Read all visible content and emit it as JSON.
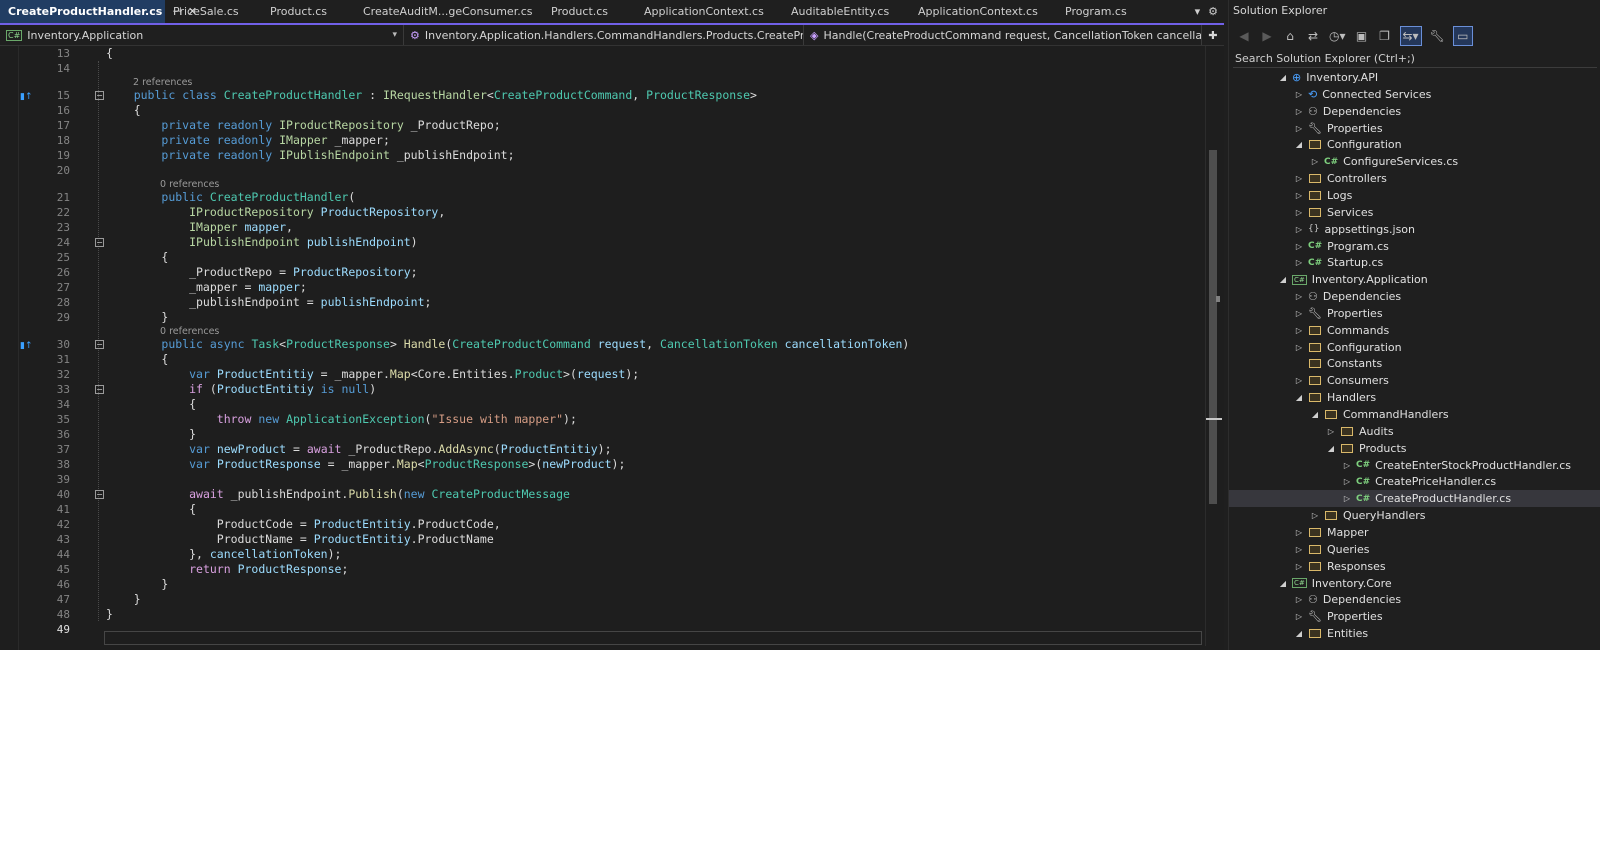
{
  "tabs": [
    {
      "label": "CreateProductHandler.cs",
      "active": true
    },
    {
      "label": "PriceSale.cs"
    },
    {
      "label": "Product.cs"
    },
    {
      "label": "CreateAuditM...geConsumer.cs"
    },
    {
      "label": "Product.cs"
    },
    {
      "label": "ApplicationContext.cs"
    },
    {
      "label": "AuditableEntity.cs"
    },
    {
      "label": "ApplicationContext.cs"
    },
    {
      "label": "Program.cs"
    }
  ],
  "tab_controls": {
    "pin": "⊣",
    "close": "✕",
    "dropdown": "▾",
    "gear": "⚙"
  },
  "navbar": {
    "project": "Inventory.Application",
    "type": "Inventory.Application.Handlers.CommandHandlers.Products.CreateProductH",
    "member": "Handle(CreateProductCommand request, CancellationToken cancellationTok",
    "add": "✚"
  },
  "code": {
    "current_line": "49",
    "lines": [
      {
        "n": "13",
        "tokens": [
          [
            "{",
            "pu"
          ]
        ]
      },
      {
        "n": "14",
        "tokens": []
      },
      {
        "n": "15",
        "lens": "2 references",
        "tokens": [
          [
            "    ",
            ""
          ],
          [
            "public",
            "kw"
          ],
          [
            " ",
            ""
          ],
          [
            "class",
            "kw"
          ],
          [
            " ",
            ""
          ],
          [
            "CreateProductHandler",
            "ty"
          ],
          [
            " : ",
            ""
          ],
          [
            "IRequestHandler",
            "if"
          ],
          [
            "<",
            ""
          ],
          [
            "CreateProductCommand",
            "ty"
          ],
          [
            ", ",
            ""
          ],
          [
            "ProductResponse",
            "ty"
          ],
          [
            ">",
            ""
          ]
        ]
      },
      {
        "n": "16",
        "tokens": [
          [
            "    {",
            ""
          ]
        ]
      },
      {
        "n": "17",
        "tokens": [
          [
            "        ",
            ""
          ],
          [
            "private",
            "kw"
          ],
          [
            " ",
            ""
          ],
          [
            "readonly",
            "kw"
          ],
          [
            " ",
            ""
          ],
          [
            "IProductRepository",
            "if"
          ],
          [
            " _ProductRepo;",
            ""
          ]
        ]
      },
      {
        "n": "18",
        "tokens": [
          [
            "        ",
            ""
          ],
          [
            "private",
            "kw"
          ],
          [
            " ",
            ""
          ],
          [
            "readonly",
            "kw"
          ],
          [
            " ",
            ""
          ],
          [
            "IMapper",
            "if"
          ],
          [
            " _mapper;",
            ""
          ]
        ]
      },
      {
        "n": "19",
        "tokens": [
          [
            "        ",
            ""
          ],
          [
            "private",
            "kw"
          ],
          [
            " ",
            ""
          ],
          [
            "readonly",
            "kw"
          ],
          [
            " ",
            ""
          ],
          [
            "IPublishEndpoint",
            "if"
          ],
          [
            " _publishEndpoint;",
            ""
          ]
        ]
      },
      {
        "n": "20",
        "tokens": []
      },
      {
        "n": "21",
        "lens": "0 references",
        "tokens": [
          [
            "        ",
            ""
          ],
          [
            "public",
            "kw"
          ],
          [
            " ",
            ""
          ],
          [
            "CreateProductHandler",
            "ty"
          ],
          [
            "(",
            ""
          ]
        ]
      },
      {
        "n": "22",
        "tokens": [
          [
            "            ",
            ""
          ],
          [
            "IProductRepository",
            "if"
          ],
          [
            " ",
            ""
          ],
          [
            "ProductRepository",
            "pr"
          ],
          [
            ",",
            ""
          ]
        ]
      },
      {
        "n": "23",
        "tokens": [
          [
            "            ",
            ""
          ],
          [
            "IMapper",
            "if"
          ],
          [
            " ",
            ""
          ],
          [
            "mapper",
            "pr"
          ],
          [
            ",",
            ""
          ]
        ]
      },
      {
        "n": "24",
        "tokens": [
          [
            "            ",
            ""
          ],
          [
            "IPublishEndpoint",
            "if"
          ],
          [
            " ",
            ""
          ],
          [
            "publishEndpoint",
            "pr"
          ],
          [
            ")",
            ""
          ]
        ]
      },
      {
        "n": "25",
        "tokens": [
          [
            "        {",
            ""
          ]
        ]
      },
      {
        "n": "26",
        "tokens": [
          [
            "            _ProductRepo = ",
            ""
          ],
          [
            "ProductRepository",
            "pr"
          ],
          [
            ";",
            ""
          ]
        ]
      },
      {
        "n": "27",
        "tokens": [
          [
            "            _mapper = ",
            ""
          ],
          [
            "mapper",
            "pr"
          ],
          [
            ";",
            ""
          ]
        ]
      },
      {
        "n": "28",
        "tokens": [
          [
            "            _publishEndpoint = ",
            ""
          ],
          [
            "publishEndpoint",
            "pr"
          ],
          [
            ";",
            ""
          ]
        ]
      },
      {
        "n": "29",
        "tokens": [
          [
            "        }",
            ""
          ]
        ]
      },
      {
        "n": "30",
        "lens": "0 references",
        "tokens": [
          [
            "        ",
            ""
          ],
          [
            "public",
            "kw"
          ],
          [
            " ",
            ""
          ],
          [
            "async",
            "kw"
          ],
          [
            " ",
            ""
          ],
          [
            "Task",
            "ty"
          ],
          [
            "<",
            ""
          ],
          [
            "ProductResponse",
            "ty"
          ],
          [
            "> ",
            ""
          ],
          [
            "Handle",
            "fn"
          ],
          [
            "(",
            ""
          ],
          [
            "CreateProductCommand",
            "ty"
          ],
          [
            " ",
            ""
          ],
          [
            "request",
            "pr"
          ],
          [
            ", ",
            ""
          ],
          [
            "CancellationToken",
            "ty"
          ],
          [
            " ",
            ""
          ],
          [
            "cancellationToken",
            "pr"
          ],
          [
            ")",
            ""
          ]
        ]
      },
      {
        "n": "31",
        "tokens": [
          [
            "        {",
            ""
          ]
        ]
      },
      {
        "n": "32",
        "tokens": [
          [
            "            ",
            ""
          ],
          [
            "var",
            "kw"
          ],
          [
            " ",
            ""
          ],
          [
            "ProductEntitiy",
            "pr"
          ],
          [
            " = _mapper.",
            ""
          ],
          [
            "Map",
            "fn"
          ],
          [
            "<Core.Entities.",
            ""
          ],
          [
            "Product",
            "ty"
          ],
          [
            ">(",
            ""
          ],
          [
            "request",
            "pr"
          ],
          [
            ");",
            ""
          ]
        ]
      },
      {
        "n": "33",
        "tokens": [
          [
            "            ",
            ""
          ],
          [
            "if",
            "kw2"
          ],
          [
            " (",
            ""
          ],
          [
            "ProductEntitiy",
            "pr"
          ],
          [
            " ",
            ""
          ],
          [
            "is",
            "kw"
          ],
          [
            " ",
            ""
          ],
          [
            "null",
            "kw"
          ],
          [
            ")",
            ""
          ]
        ]
      },
      {
        "n": "34",
        "tokens": [
          [
            "            {",
            ""
          ]
        ]
      },
      {
        "n": "35",
        "tokens": [
          [
            "                ",
            ""
          ],
          [
            "throw",
            "kw2"
          ],
          [
            " ",
            ""
          ],
          [
            "new",
            "kw"
          ],
          [
            " ",
            ""
          ],
          [
            "ApplicationException",
            "ty"
          ],
          [
            "(",
            ""
          ],
          [
            "\"Issue with mapper\"",
            "st"
          ],
          [
            ");",
            ""
          ]
        ]
      },
      {
        "n": "36",
        "tokens": [
          [
            "            }",
            ""
          ]
        ]
      },
      {
        "n": "37",
        "tokens": [
          [
            "            ",
            ""
          ],
          [
            "var",
            "kw"
          ],
          [
            " ",
            ""
          ],
          [
            "newProduct",
            "pr"
          ],
          [
            " = ",
            ""
          ],
          [
            "await",
            "kw2"
          ],
          [
            " _ProductRepo.",
            ""
          ],
          [
            "AddAsync",
            "fn"
          ],
          [
            "(",
            ""
          ],
          [
            "ProductEntitiy",
            "pr"
          ],
          [
            ");",
            ""
          ]
        ]
      },
      {
        "n": "38",
        "tokens": [
          [
            "            ",
            ""
          ],
          [
            "var",
            "kw"
          ],
          [
            " ",
            ""
          ],
          [
            "ProductResponse",
            "pr"
          ],
          [
            " = _mapper.",
            ""
          ],
          [
            "Map",
            "fn"
          ],
          [
            "<",
            ""
          ],
          [
            "ProductResponse",
            "ty"
          ],
          [
            ">(",
            ""
          ],
          [
            "newProduct",
            "pr"
          ],
          [
            ");",
            ""
          ]
        ]
      },
      {
        "n": "39",
        "tokens": []
      },
      {
        "n": "40",
        "tokens": [
          [
            "            ",
            ""
          ],
          [
            "await",
            "kw2"
          ],
          [
            " _publishEndpoint.",
            ""
          ],
          [
            "Publish",
            "fn"
          ],
          [
            "(",
            ""
          ],
          [
            "new",
            "kw"
          ],
          [
            " ",
            ""
          ],
          [
            "CreateProductMessage",
            "ty"
          ]
        ]
      },
      {
        "n": "41",
        "tokens": [
          [
            "            {",
            ""
          ]
        ]
      },
      {
        "n": "42",
        "tokens": [
          [
            "                ProductCode = ",
            ""
          ],
          [
            "ProductEntitiy",
            "pr"
          ],
          [
            ".ProductCode,",
            ""
          ]
        ]
      },
      {
        "n": "43",
        "tokens": [
          [
            "                ProductName = ",
            ""
          ],
          [
            "ProductEntitiy",
            "pr"
          ],
          [
            ".ProductName",
            ""
          ]
        ]
      },
      {
        "n": "44",
        "tokens": [
          [
            "            }, ",
            ""
          ],
          [
            "cancellationToken",
            "pr"
          ],
          [
            ");",
            ""
          ]
        ]
      },
      {
        "n": "45",
        "tokens": [
          [
            "            ",
            ""
          ],
          [
            "return",
            "kw2"
          ],
          [
            " ",
            ""
          ],
          [
            "ProductResponse",
            "pr"
          ],
          [
            ";",
            ""
          ]
        ]
      },
      {
        "n": "46",
        "tokens": [
          [
            "        }",
            ""
          ]
        ]
      },
      {
        "n": "47",
        "tokens": [
          [
            "    }",
            ""
          ]
        ]
      },
      {
        "n": "48",
        "tokens": [
          [
            "}",
            ""
          ]
        ]
      },
      {
        "n": "49",
        "tokens": []
      }
    ]
  },
  "solution_explorer": {
    "title": "Solution Explorer",
    "search_placeholder": "Search Solution Explorer (Ctrl+;)",
    "toolbar_icons": [
      "back-icon",
      "forward-icon",
      "home-icon",
      "switch-views-icon",
      "history-icon",
      "collapse-all-icon",
      "copy-icon",
      "sync-icon",
      "wrench-icon",
      "preview-icon"
    ],
    "nodes": [
      {
        "label": "Inventory.API",
        "depth": 0,
        "icon": "web-project",
        "state": "expanded"
      },
      {
        "label": "Connected Services",
        "depth": 1,
        "icon": "connected-services",
        "state": "collapsed"
      },
      {
        "label": "Dependencies",
        "depth": 1,
        "icon": "dependencies",
        "state": "collapsed"
      },
      {
        "label": "Properties",
        "depth": 1,
        "icon": "properties",
        "state": "collapsed"
      },
      {
        "label": "Configuration",
        "depth": 1,
        "icon": "folder",
        "state": "expanded"
      },
      {
        "label": "ConfigureServices.cs",
        "depth": 2,
        "icon": "csharp",
        "state": "collapsed"
      },
      {
        "label": "Controllers",
        "depth": 1,
        "icon": "folder",
        "state": "collapsed"
      },
      {
        "label": "Logs",
        "depth": 1,
        "icon": "folder",
        "state": "collapsed"
      },
      {
        "label": "Services",
        "depth": 1,
        "icon": "folder",
        "state": "collapsed"
      },
      {
        "label": "appsettings.json",
        "depth": 1,
        "icon": "json",
        "state": "collapsed"
      },
      {
        "label": "Program.cs",
        "depth": 1,
        "icon": "csharp",
        "state": "collapsed"
      },
      {
        "label": "Startup.cs",
        "depth": 1,
        "icon": "csharp",
        "state": "collapsed"
      },
      {
        "label": "Inventory.Application",
        "depth": 0,
        "icon": "project",
        "state": "expanded"
      },
      {
        "label": "Dependencies",
        "depth": 1,
        "icon": "dependencies",
        "state": "collapsed"
      },
      {
        "label": "Properties",
        "depth": 1,
        "icon": "properties",
        "state": "collapsed"
      },
      {
        "label": "Commands",
        "depth": 1,
        "icon": "folder",
        "state": "collapsed"
      },
      {
        "label": "Configuration",
        "depth": 1,
        "icon": "folder",
        "state": "collapsed"
      },
      {
        "label": "Constants",
        "depth": 1,
        "icon": "folder",
        "state": "none"
      },
      {
        "label": "Consumers",
        "depth": 1,
        "icon": "folder",
        "state": "collapsed"
      },
      {
        "label": "Handlers",
        "depth": 1,
        "icon": "folder",
        "state": "expanded"
      },
      {
        "label": "CommandHandlers",
        "depth": 2,
        "icon": "folder",
        "state": "expanded"
      },
      {
        "label": "Audits",
        "depth": 3,
        "icon": "folder",
        "state": "collapsed"
      },
      {
        "label": "Products",
        "depth": 3,
        "icon": "folder",
        "state": "expanded"
      },
      {
        "label": "CreateEnterStockProductHandler.cs",
        "depth": 4,
        "icon": "csharp",
        "state": "collapsed"
      },
      {
        "label": "CreatePriceHandler.cs",
        "depth": 4,
        "icon": "csharp",
        "state": "collapsed"
      },
      {
        "label": "CreateProductHandler.cs",
        "depth": 4,
        "icon": "csharp",
        "state": "collapsed",
        "selected": true
      },
      {
        "label": "QueryHandlers",
        "depth": 2,
        "icon": "folder",
        "state": "collapsed"
      },
      {
        "label": "Mapper",
        "depth": 1,
        "icon": "folder",
        "state": "collapsed"
      },
      {
        "label": "Queries",
        "depth": 1,
        "icon": "folder",
        "state": "collapsed"
      },
      {
        "label": "Responses",
        "depth": 1,
        "icon": "folder",
        "state": "collapsed"
      },
      {
        "label": "Inventory.Core",
        "depth": 0,
        "icon": "project",
        "state": "expanded"
      },
      {
        "label": "Dependencies",
        "depth": 1,
        "icon": "dependencies",
        "state": "collapsed"
      },
      {
        "label": "Properties",
        "depth": 1,
        "icon": "properties",
        "state": "collapsed"
      },
      {
        "label": "Entities",
        "depth": 1,
        "icon": "folder",
        "state": "expanded"
      }
    ]
  }
}
